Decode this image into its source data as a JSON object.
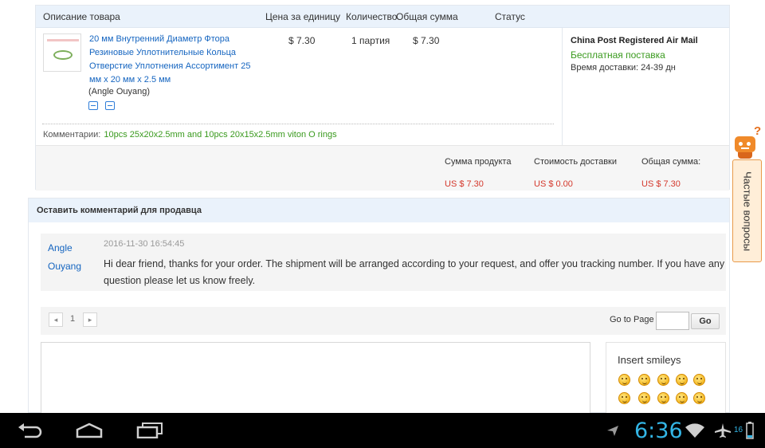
{
  "order_table": {
    "headers": {
      "description": "Описание товара",
      "unit_price": "Цена за единицу",
      "quantity": "Количество",
      "total": "Общая сумма",
      "status": "Статус"
    },
    "item": {
      "title": "20 мм Внутренний Диаметр Фтора Резиновые Уплотнительные Кольца Отверстие Уплотнения Ассортимент 25 мм x 20 мм x 2.5 мм",
      "seller": "(Angle Ouyang)",
      "unit_price": "$ 7.30",
      "quantity": "1 партия",
      "total": "$ 7.30",
      "icons": [
        "delivery-truck-icon",
        "exchange-icon"
      ]
    },
    "shipping": {
      "method": "China Post Registered Air Mail",
      "free": "Бесплатная поставка",
      "time_label": "Время доставки:",
      "time_value": "24-39 дн"
    },
    "comment": {
      "label": "Комментарии:",
      "value": "10pcs 25x20x2.5mm and 10pcs 20x15x2.5mm viton O rings"
    },
    "totals": {
      "product_label": "Сумма продукта",
      "product_value": "US $ 7.30",
      "shipping_label": "Стоимость доставки",
      "shipping_value": "US $ 0.00",
      "total_label": "Общая сумма:",
      "total_value": "US $ 7.30"
    }
  },
  "messages": {
    "header": "Оставить комментарий для продавца",
    "items": [
      {
        "author": "Angle Ouyang",
        "date": "2016-11-30 16:54:45",
        "text": "Hi dear friend, thanks for your order. The shipment will be arranged according to your request, and offer you tracking number. If you have any question please let us know freely."
      }
    ],
    "pagination": {
      "page": "1",
      "goto_label": "Go to Page",
      "goto_value": "",
      "go_button": "Go"
    },
    "reply": {
      "value": "",
      "smileys_title": "Insert smileys"
    }
  },
  "faq_button": {
    "label": "Частые вопросы",
    "icon": "robot-help-icon"
  },
  "system_bar": {
    "time": "6:36",
    "battery": "16",
    "icons": [
      "back-icon",
      "home-icon",
      "recent-apps-icon",
      "notification-plane-icon",
      "wifi-icon",
      "airplane-mode-icon",
      "battery-icon"
    ],
    "accent_color": "#33b5e5"
  }
}
